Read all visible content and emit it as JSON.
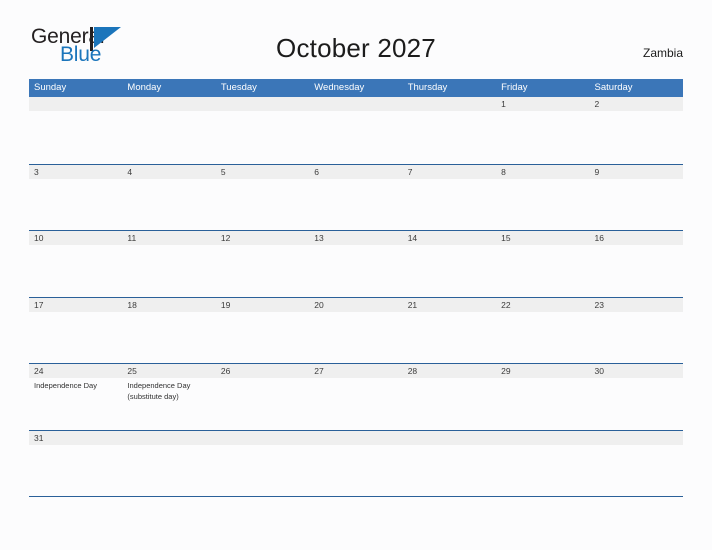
{
  "brand": {
    "name_part1": "General",
    "name_part2": "Blue",
    "flag_icon": "blue-flag-triangle-icon",
    "color_dark": "#231f20",
    "color_blue": "#1b75bb"
  },
  "header": {
    "title": "October 2027",
    "country": "Zambia"
  },
  "theme": {
    "header_blue": "#3b76b8",
    "divider_blue": "#2a6099",
    "band_gray": "#efefef",
    "page_background": "#fcfcfd"
  },
  "calendar": {
    "weekdays": [
      "Sunday",
      "Monday",
      "Tuesday",
      "Wednesday",
      "Thursday",
      "Friday",
      "Saturday"
    ],
    "weeks": [
      {
        "days": [
          {
            "num": "",
            "event": ""
          },
          {
            "num": "",
            "event": ""
          },
          {
            "num": "",
            "event": ""
          },
          {
            "num": "",
            "event": ""
          },
          {
            "num": "",
            "event": ""
          },
          {
            "num": "1",
            "event": ""
          },
          {
            "num": "2",
            "event": ""
          }
        ]
      },
      {
        "days": [
          {
            "num": "3",
            "event": ""
          },
          {
            "num": "4",
            "event": ""
          },
          {
            "num": "5",
            "event": ""
          },
          {
            "num": "6",
            "event": ""
          },
          {
            "num": "7",
            "event": ""
          },
          {
            "num": "8",
            "event": ""
          },
          {
            "num": "9",
            "event": ""
          }
        ]
      },
      {
        "days": [
          {
            "num": "10",
            "event": ""
          },
          {
            "num": "11",
            "event": ""
          },
          {
            "num": "12",
            "event": ""
          },
          {
            "num": "13",
            "event": ""
          },
          {
            "num": "14",
            "event": ""
          },
          {
            "num": "15",
            "event": ""
          },
          {
            "num": "16",
            "event": ""
          }
        ]
      },
      {
        "days": [
          {
            "num": "17",
            "event": ""
          },
          {
            "num": "18",
            "event": ""
          },
          {
            "num": "19",
            "event": ""
          },
          {
            "num": "20",
            "event": ""
          },
          {
            "num": "21",
            "event": ""
          },
          {
            "num": "22",
            "event": ""
          },
          {
            "num": "23",
            "event": ""
          }
        ]
      },
      {
        "days": [
          {
            "num": "24",
            "event": "Independence Day"
          },
          {
            "num": "25",
            "event": "Independence Day (substitute day)"
          },
          {
            "num": "26",
            "event": ""
          },
          {
            "num": "27",
            "event": ""
          },
          {
            "num": "28",
            "event": ""
          },
          {
            "num": "29",
            "event": ""
          },
          {
            "num": "30",
            "event": ""
          }
        ]
      },
      {
        "days": [
          {
            "num": "31",
            "event": ""
          },
          {
            "num": "",
            "event": ""
          },
          {
            "num": "",
            "event": ""
          },
          {
            "num": "",
            "event": ""
          },
          {
            "num": "",
            "event": ""
          },
          {
            "num": "",
            "event": ""
          },
          {
            "num": "",
            "event": ""
          }
        ]
      }
    ]
  }
}
